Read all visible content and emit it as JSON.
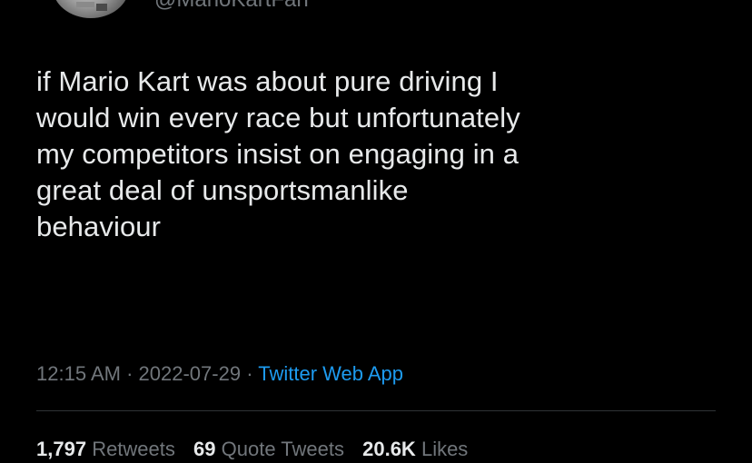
{
  "tweet": {
    "handle": "@MarioKartFan",
    "text": "if Mario Kart was about pure driving I\nwould win every race but unfortunately\nmy competitors insist on engaging in a\ngreat deal of unsportsmanlike\nbehaviour",
    "time": "12:15 AM",
    "date": "2022-07-29",
    "separator": "·",
    "source": "Twitter Web App"
  },
  "stats": {
    "retweets_count": "1,797",
    "retweets_label": "Retweets",
    "quotes_count": "69",
    "quotes_label": "Quote Tweets",
    "likes_count": "20.6K",
    "likes_label": "Likes"
  },
  "colors": {
    "background": "#000000",
    "text": "#e7e9ea",
    "secondary": "#71767b",
    "accent": "#1d9bf0"
  }
}
